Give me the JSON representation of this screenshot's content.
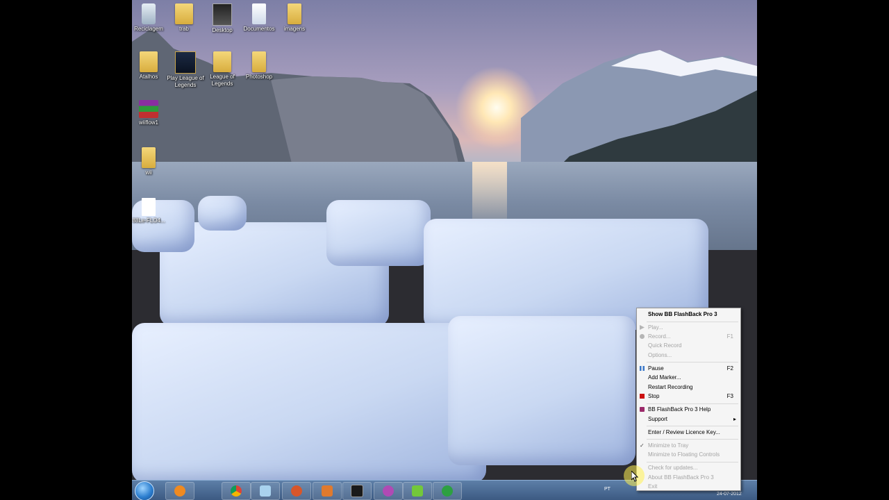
{
  "desktop_icons": [
    {
      "label": "Reciclagem",
      "icon": "recycle-bin-icon"
    },
    {
      "label": "trab",
      "icon": "folder-icon"
    },
    {
      "label": "Desktop",
      "icon": "folder-icon"
    },
    {
      "label": "Documentos",
      "icon": "documents-icon"
    },
    {
      "label": "imagens",
      "icon": "folder-icon"
    },
    {
      "label": "Atalhos",
      "icon": "folder-icon"
    },
    {
      "label": "Play League of Legends",
      "icon": "league-icon"
    },
    {
      "label": "League of Legends",
      "icon": "folder-icon"
    },
    {
      "label": "Photoshop",
      "icon": "folder-icon"
    },
    {
      "label": "wiiflow1",
      "icon": "winrar-icon"
    },
    {
      "label": "wii",
      "icon": "folder-icon"
    },
    {
      "label": "88Le-FLO4...",
      "icon": "file-icon"
    }
  ],
  "context_menu": {
    "header": "Show BB FlashBack Pro 3",
    "items": {
      "play": {
        "label": "Play...",
        "enabled": false
      },
      "record": {
        "label": "Record...",
        "key": "F1",
        "enabled": false
      },
      "quick_record": {
        "label": "Quick Record",
        "enabled": false
      },
      "options": {
        "label": "Options...",
        "enabled": false
      },
      "pause": {
        "label": "Pause",
        "key": "F2",
        "enabled": true
      },
      "add_marker": {
        "label": "Add Marker...",
        "enabled": true
      },
      "restart": {
        "label": "Restart Recording",
        "enabled": true
      },
      "stop": {
        "label": "Stop",
        "key": "F3",
        "enabled": true
      },
      "help": {
        "label": "BB FlashBack Pro 3 Help",
        "enabled": true
      },
      "support": {
        "label": "Support",
        "enabled": true
      },
      "licence": {
        "label": "Enter / Review Licence Key...",
        "enabled": true
      },
      "min_tray": {
        "label": "Minimize to Tray",
        "enabled": false,
        "checked": true
      },
      "min_float": {
        "label": "Minimize to Floating Controls",
        "enabled": false
      },
      "check_updates": {
        "label": "Check for updates...",
        "enabled": false
      },
      "about": {
        "label": "About BB FlashBack Pro 3",
        "enabled": false
      },
      "exit": {
        "label": "Exit",
        "enabled": false
      }
    }
  },
  "taskbar": {
    "language": "PT",
    "date": "24-07-2012",
    "apps": [
      "windows-media-player-icon",
      "chrome-icon",
      "explorer-icon",
      "utility-icon",
      "office-icon",
      "terminal-icon",
      "media-icon",
      "utorrent-green-icon",
      "utorrent-icon"
    ]
  },
  "colors": {
    "menu_bg": "#f5f5f5",
    "taskbar": "#4a6a95",
    "stop_red": "#cc1111",
    "pause_blue": "#3a78c8"
  }
}
